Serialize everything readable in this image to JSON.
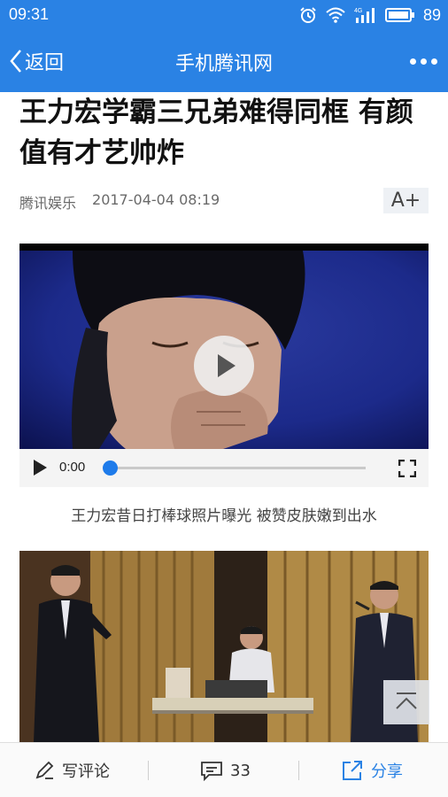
{
  "status_bar": {
    "time": "09:31",
    "battery": "89",
    "network": "4G"
  },
  "nav": {
    "back_label": "返回",
    "title": "手机腾讯网"
  },
  "article": {
    "title_line1": "王力宏学霸三兄弟难得同框 有颜",
    "title_line2": "值有才艺帅炸",
    "source": "腾讯娱乐",
    "datetime": "2017-04-04 08:19",
    "font_button": "A+"
  },
  "video": {
    "time": "0:00",
    "progress": 0.0,
    "caption": "王力宏昔日打棒球照片曝光 被赞皮肤嫩到出水"
  },
  "bottom_bar": {
    "comment_label": "写评论",
    "comment_count": "33",
    "share_label": "分享"
  },
  "colors": {
    "brand_blue": "#2a82e4",
    "accent_blue": "#1e7bea"
  },
  "icons": [
    "alarm-icon",
    "wifi-icon",
    "signal-icon",
    "battery-icon",
    "back-chevron-icon",
    "more-icon",
    "play-icon",
    "fullscreen-icon",
    "scroll-top-icon",
    "pen-icon",
    "comment-icon",
    "share-icon"
  ]
}
